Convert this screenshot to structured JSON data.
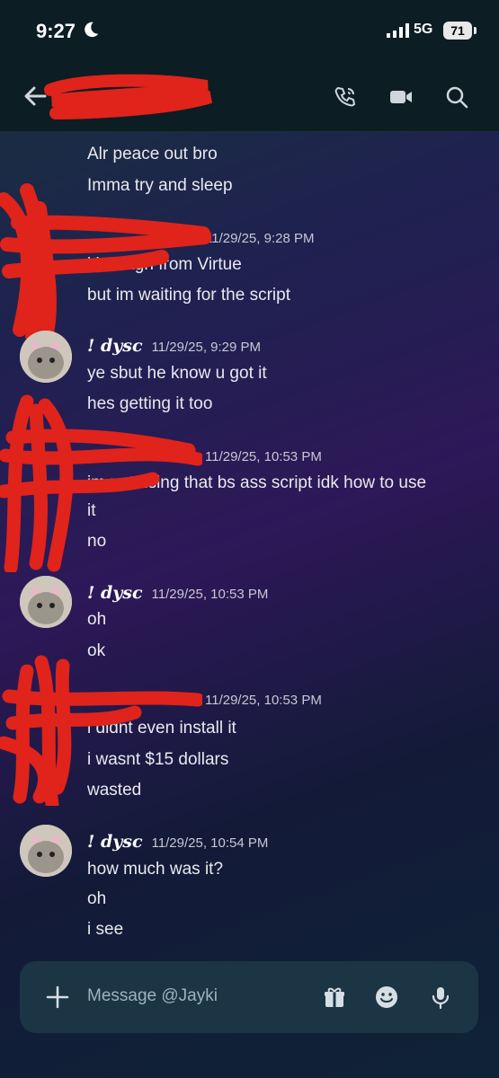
{
  "status": {
    "time": "9:27",
    "network": "5G",
    "battery": "71"
  },
  "header": {
    "contact": "",
    "icons": [
      "back-arrow-icon",
      "voice-call-icon",
      "video-call-icon",
      "search-icon"
    ]
  },
  "messages": [
    {
      "lines": [
        "Alr peace out bro",
        "Imma try and sleep"
      ]
    },
    {
      "timestamp": "11/29/25, 9:28 PM",
      "lines": [
        "i broutgh from Virtue",
        "but im waiting for the script"
      ]
    },
    {
      "username": "! dysc",
      "timestamp": "11/29/25, 9:29 PM",
      "lines": [
        "ye sbut he know u got it",
        "hes getting it too"
      ]
    },
    {
      "timestamp": "11/29/25, 10:53 PM",
      "lines": [
        "im not using that bs ass script idk how to use",
        "it",
        "no"
      ]
    },
    {
      "username": "! dysc",
      "timestamp": "11/29/25, 10:53 PM",
      "lines": [
        "oh",
        "ok"
      ]
    },
    {
      "timestamp": "11/29/25, 10:53 PM",
      "lines": [
        "i didnt even install it",
        "i wasnt $15 dollars",
        "wasted"
      ]
    },
    {
      "username": "! dysc",
      "timestamp": "11/29/25, 10:54 PM",
      "lines": [
        "how much was it?",
        "oh",
        "i see"
      ]
    }
  ],
  "composer": {
    "placeholder": "Message @Jayki",
    "icons": [
      "plus-icon",
      "gift-icon",
      "emoji-icon",
      "microphone-icon"
    ]
  },
  "colors": {
    "redaction": "#e0231b",
    "header_bg": "#0c1d24",
    "composer_bg": "#1b3545"
  }
}
